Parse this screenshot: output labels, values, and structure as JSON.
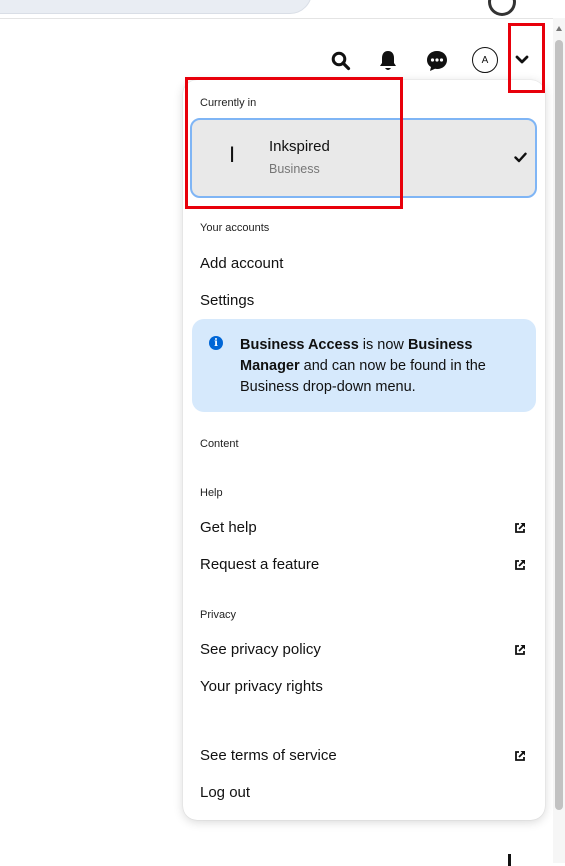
{
  "header": {
    "search_icon": "search-icon",
    "bell_icon": "bell-icon",
    "messages_icon": "chat-bubble-icon",
    "avatar_initial": "A",
    "accounts_chevron_icon": "chevron-down-icon"
  },
  "menu": {
    "currently_in_label": "Currently in",
    "current_account": {
      "initial": "I",
      "name": "Inkspired",
      "type": "Business",
      "selected_icon": "checkmark-icon"
    },
    "your_accounts_label": "Your accounts",
    "add_account_label": "Add account",
    "settings_label": "Settings",
    "notice": {
      "icon": "info-icon",
      "part1_bold": "Business Access",
      "part2": " is now ",
      "part3_bold": "Business Manager",
      "part4": " and can now be found in the Business drop-down menu."
    },
    "content_label": "Content",
    "help_label": "Help",
    "get_help_label": "Get help",
    "request_feature_label": "Request a feature",
    "privacy_label": "Privacy",
    "privacy_policy_label": "See privacy policy",
    "privacy_rights_label": "Your privacy rights",
    "terms_label": "See terms of service",
    "logout_label": "Log out"
  },
  "colors": {
    "highlight_box": "#e8000b",
    "card_border": "#7fb5f5",
    "notice_bg": "#d6e9fc",
    "info_icon": "#0066d6"
  }
}
